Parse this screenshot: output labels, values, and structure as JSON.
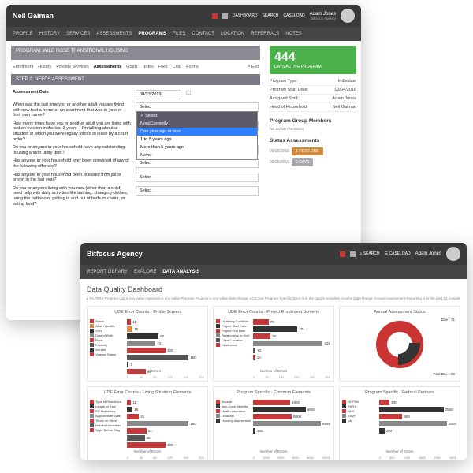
{
  "w1": {
    "brand": "Neil Gaiman",
    "user": "Adam Jones",
    "role": "Bitfocus Agency",
    "topIcons": [
      "DASHBOARD",
      "SEARCH",
      "CASELOAD"
    ],
    "nav": [
      "PROFILE",
      "HISTORY",
      "SERVICES",
      "ASSESSMENTS",
      "PROGRAMS",
      "FILES",
      "CONTACT",
      "LOCATION",
      "REFERRALS",
      "NOTES"
    ],
    "navActive": "PROGRAMS",
    "program": "PROGRAM: WILD ROSE TRANSITIONAL HOUSING",
    "tabs": [
      "Enrollment",
      "History",
      "Provide Services",
      "Assessments",
      "Goals",
      "Notes",
      "Files",
      "Chat",
      "Forms"
    ],
    "tabActive": "Assessments",
    "exit": "× Exit",
    "step": "STEP 2: NEEDS ASSESSMENT",
    "form": {
      "dateLabel": "Assessment Date",
      "dateValue": "08/23/2019",
      "q1": "When was the last time you or another adult you are living with now had a home or an apartment that was in your or their own name?",
      "q2": "How many times have you or another adult you are living with had an eviction in the last 3 years – I'm talking about a situation in which you were legally forced to leave by a court order?",
      "q3": "Do you or anyone in your household have any outstanding housing and/or utility debt?",
      "q4": "Has anyone in your household ever been convicted of any of the following offenses?",
      "q5": "Has anyone in your household been released from jail or prison in the last year?",
      "q6": "Do you or anyone living with you now (other than a child) need help with daily activities like bathing, changing clothes, using the bathroom, getting in and out of beds or chairs, or eating food?",
      "selectPlaceholder": "Select",
      "options": [
        "✓ Select",
        "Now/Currently",
        "One year ago or less",
        "1 to 5 years ago",
        "More than 5 years ago",
        "Never"
      ]
    },
    "side": {
      "days": "444",
      "daysLabel": "DAYS\nACTIVE PROGRAM",
      "kv": [
        {
          "k": "Program Type",
          "v": "Individual"
        },
        {
          "k": "Program Start Date",
          "v": "03/04/2018"
        },
        {
          "k": "Assigned Staff",
          "v": "Adam Jones"
        },
        {
          "k": "Head of Household",
          "v": "Neil Gaiman"
        }
      ],
      "groupHead": "Program Group Members",
      "noMembers": "No active members",
      "statusHead": "Status Assessments",
      "pills": [
        {
          "d": "09/25/2018",
          "l": "1 YEAR DUE"
        },
        {
          "d": "09/25/2019",
          "l": "6 DAYS"
        }
      ]
    }
  },
  "w2": {
    "brand": "Bitfocus Agency",
    "user": "Adam Jones",
    "nav": [
      "REPORT LIBRARY",
      "EXPLORE",
      "DATA ANALYSIS"
    ],
    "navActive": "DATA ANALYSIS",
    "dashTitle": "Data Quality Dashboard",
    "filters": "▸ FILTERS   Program List is any value   Agencies is any value   Program Projects is any value   Data Range: LOS and Program Specific Error is in the past 3 complete months   Date Range: Annual Assessment Reporting is in the past 12 complete months"
  },
  "chart_data": [
    {
      "type": "bar",
      "orientation": "h",
      "title": "UDE Error Counts - Profile Screen",
      "xlabel": "Number of Errors",
      "xlim": [
        0,
        200
      ],
      "series": [
        {
          "name": "Name",
          "value": 11,
          "color": "#c43a3a"
        },
        {
          "name": "Alias / Quality",
          "value": 15,
          "color": "#d98c4a"
        },
        {
          "name": "SSN",
          "value": 82,
          "color": "#333333"
        },
        {
          "name": "Date of Birth",
          "value": 74,
          "color": "#888888"
        },
        {
          "name": "Race",
          "value": 100,
          "color": "#c43a3a"
        },
        {
          "name": "Ethnicity",
          "value": 160,
          "color": "#555555"
        },
        {
          "name": "Gender",
          "value": 5,
          "color": "#333333"
        },
        {
          "name": "Veteran Status",
          "value": 49,
          "color": "#c43a3a"
        }
      ]
    },
    {
      "type": "bar",
      "orientation": "h",
      "title": "UDE Error Counts - Project Enrollment Screens",
      "xlabel": "Number of Errors",
      "xlim": [
        0,
        350
      ],
      "series": [
        {
          "name": "Disabling Condition",
          "value": 70,
          "color": "#c43a3a"
        },
        {
          "name": "Project Start Date",
          "value": 201,
          "color": "#333333"
        },
        {
          "name": "Project End Date",
          "value": 80,
          "color": "#c43a3a"
        },
        {
          "name": "Relationship to HoH",
          "value": 331,
          "color": "#888888"
        },
        {
          "name": "Client Location",
          "value": 12,
          "color": "#555555"
        },
        {
          "name": "Destination",
          "value": 10,
          "color": "#c43a3a"
        }
      ]
    },
    {
      "type": "pie",
      "title": "Annual Assessment Status",
      "series": [
        {
          "name": "Due",
          "value": 71,
          "color": "#c43a3a"
        },
        {
          "name": "Past Due",
          "value": 29,
          "color": "#333333"
        }
      ]
    },
    {
      "type": "bar",
      "orientation": "h",
      "title": "UDE Error Counts - Living Situation Elements",
      "xlabel": "Number of Errors",
      "xlim": [
        0,
        200
      ],
      "series": [
        {
          "name": "Type of Residence",
          "value": 11,
          "color": "#c43a3a"
        },
        {
          "name": "Length of Stay",
          "value": 15,
          "color": "#333333"
        },
        {
          "name": "PIT Homeless",
          "value": 31,
          "color": "#c43a3a"
        },
        {
          "name": "Approximate Date",
          "value": 160,
          "color": "#888888"
        },
        {
          "name": "Times on Street",
          "value": 51,
          "color": "#c43a3a"
        },
        {
          "name": "Months Homeless",
          "value": 46,
          "color": "#555555"
        },
        {
          "name": "Night Before Stay",
          "value": 100,
          "color": "#c43a3a"
        }
      ]
    },
    {
      "type": "bar",
      "orientation": "h",
      "title": "Program Specific - Common Elements",
      "xlabel": "Number of Errors",
      "xlim": [
        0,
        10000
      ],
      "series": [
        {
          "name": "Income",
          "value": 4800,
          "color": "#c43a3a"
        },
        {
          "name": "Non-Cash Benefits",
          "value": 6800,
          "color": "#333333"
        },
        {
          "name": "Health Insurance",
          "value": 5000,
          "color": "#c43a3a"
        },
        {
          "name": "Disability",
          "value": 8888,
          "color": "#888888"
        },
        {
          "name": "Housing Assessment",
          "value": 300,
          "color": "#333333"
        }
      ]
    },
    {
      "type": "bar",
      "orientation": "h",
      "title": "Program Specific - Federal Partners",
      "xlabel": "Number of Errors",
      "xlim": [
        0,
        3000
      ],
      "series": [
        {
          "name": "HOPWA",
          "value": 400,
          "color": "#c43a3a"
        },
        {
          "name": "PATH",
          "value": 2500,
          "color": "#333333"
        },
        {
          "name": "RHY",
          "value": 900,
          "color": "#c43a3a"
        },
        {
          "name": "SSVF",
          "value": 2800,
          "color": "#888888"
        },
        {
          "name": "VA",
          "value": 200,
          "color": "#333333"
        }
      ]
    }
  ]
}
